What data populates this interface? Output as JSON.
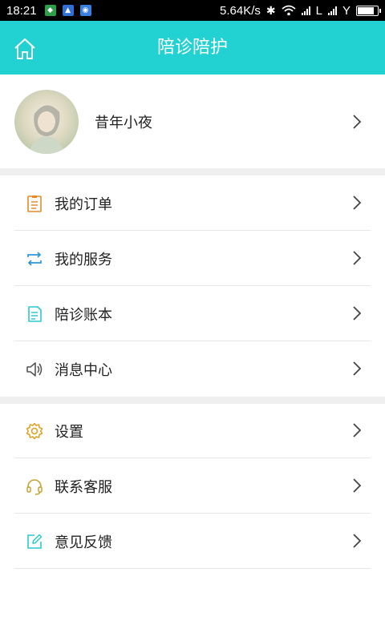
{
  "status_bar": {
    "time": "18:21",
    "speed": "5.64K/s",
    "carrier_l": "L",
    "carrier_y": "Y",
    "battery_level": 0.9
  },
  "header": {
    "title": "陪诊陪护",
    "home_icon": "home-icon",
    "accent_color": "#22d2d2"
  },
  "profile": {
    "name": "昔年小夜"
  },
  "menu_group_1": [
    {
      "label": "我的订单",
      "icon": "order-list-icon",
      "color": "#e58a2a"
    },
    {
      "label": "我的服务",
      "icon": "service-swap-icon",
      "color": "#2f96d6"
    },
    {
      "label": "陪诊账本",
      "icon": "ledger-icon",
      "color": "#2ac9d0"
    },
    {
      "label": "消息中心",
      "icon": "speaker-icon",
      "color": "#555555"
    }
  ],
  "menu_group_2": [
    {
      "label": "设置",
      "icon": "gear-icon",
      "color": "#e0a020"
    },
    {
      "label": "联系客服",
      "icon": "headset-icon",
      "color": "#c8a030"
    },
    {
      "label": "意见反馈",
      "icon": "feedback-edit-icon",
      "color": "#2ac9d0"
    }
  ]
}
